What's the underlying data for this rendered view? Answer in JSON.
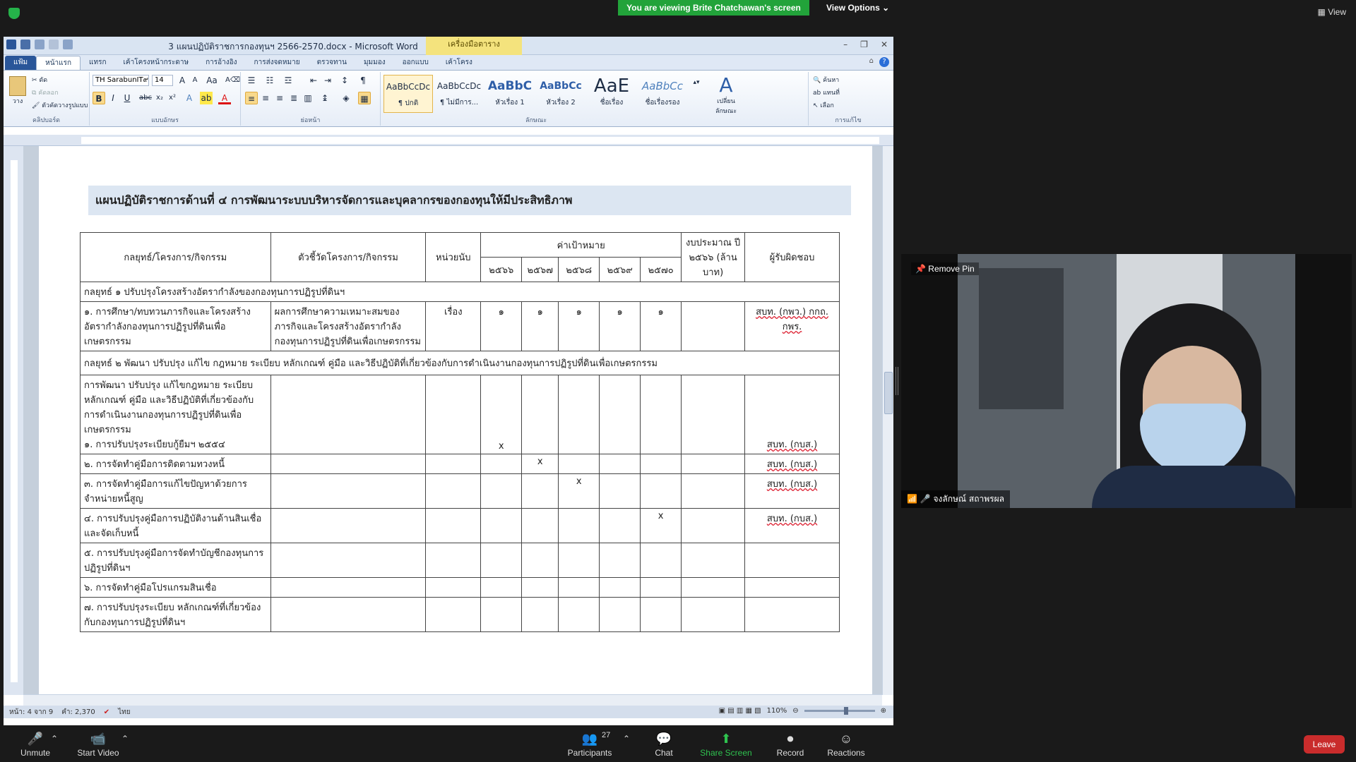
{
  "zoom": {
    "viewing_banner": "You are viewing Brite Chatchawan's screen",
    "view_options": "View Options ⌄",
    "view": "View",
    "pin_label": "Remove Pin",
    "participant_name": "จงลักษณ์ สถาพรผล",
    "participants_count": "27",
    "toolbar": {
      "unmute": "Unmute",
      "start_video": "Start Video",
      "participants": "Participants",
      "chat": "Chat",
      "share_screen": "Share Screen",
      "record": "Record",
      "reactions": "Reactions",
      "leave": "Leave"
    }
  },
  "word": {
    "title": "3 แผนปฏิบัติราชการกองทุนฯ 2566-2570.docx - Microsoft Word",
    "context_tab": "เครื่องมือตาราง",
    "tabs": [
      "แฟ้ม",
      "หน้าแรก",
      "แทรก",
      "เค้าโครงหน้ากระดาษ",
      "การอ้างอิง",
      "การส่งจดหมาย",
      "ตรวจทาน",
      "มุมมอง",
      "ออกแบบ",
      "เค้าโครง"
    ],
    "ribbon": {
      "paste": "วาง",
      "cut": "ตัด",
      "copy": "คัดลอก",
      "format_painter": "ตัวคัดวางรูปแบบ",
      "clipboard_label": "คลิปบอร์ด",
      "font_name": "TH SarabunIT๙",
      "font_size": "14",
      "font_label": "แบบอักษร",
      "paragraph_label": "ย่อหน้า",
      "styles_label": "ลักษณะ",
      "editing_label": "การแก้ไข",
      "change_styles": "เปลี่ยนลักษณะ",
      "find": "ค้นหา",
      "replace": "แทนที่",
      "select": "เลือก",
      "styles": [
        {
          "sample": "AaBbCcDc",
          "name": "¶ ปกติ"
        },
        {
          "sample": "AaBbCcDc",
          "name": "¶ ไม่มีการ..."
        },
        {
          "sample": "AaBbC",
          "name": "หัวเรื่อง 1"
        },
        {
          "sample": "AaBbCc",
          "name": "หัวเรื่อง 2"
        },
        {
          "sample": "AaE",
          "name": "ชื่อเรื่อง"
        },
        {
          "sample": "AaBbCc",
          "name": "ชื่อเรื่องรอง"
        }
      ]
    },
    "status": {
      "page": "หน้า: 4 จาก 9",
      "words": "คำ: 2,370",
      "language": "ไทย",
      "zoom": "110%"
    }
  },
  "document": {
    "heading": "แผนปฏิบัติราชการด้านที่ ๔ การพัฒนาระบบบริหารจัดการและบุคลากรของกองทุนให้มีประสิทธิภาพ",
    "headers": {
      "strategy": "กลยุทธ์/โครงการ/กิจกรรม",
      "indicator": "ตัวชี้วัดโครงการ/กิจกรรม",
      "unit": "หน่วยนับ",
      "target": "ค่าเป้าหมาย",
      "years": [
        "๒๕๖๖",
        "๒๕๖๗",
        "๒๕๖๘",
        "๒๕๖๙",
        "๒๕๗๐"
      ],
      "budget": "งบประมาณ ปี ๒๕๖๖ (ล้านบาท)",
      "owner": "ผู้รับผิดชอบ"
    },
    "strategy1": "กลยุทธ์ ๑ ปรับปรุงโครงสร้างอัตรากำลังของกองทุนการปฏิรูปที่ดินฯ",
    "row1": {
      "item": "๑. การศึกษา/ทบทวนภารกิจและโครงสร้างอัตรากำลังกองทุนการปฏิรูปที่ดินเพื่อเกษตรกรรม",
      "indicator": "ผลการศึกษาความเหมาะสมของภารกิจและโครงสร้างอัตรากำลังกองทุนการปฏิรูปที่ดินเพื่อเกษตรกรรม",
      "unit": "เรื่อง",
      "y1": "๑",
      "y2": "๑",
      "y3": "๑",
      "y4": "๑",
      "y5": "๑",
      "owner": "สบท. (กพว.) กกถ. กพร."
    },
    "strategy2": "กลยุทธ์ ๒ พัฒนา ปรับปรุง แก้ไข กฎหมาย ระเบียบ หลักเกณฑ์ คู่มือ และวิธีปฏิบัติที่เกี่ยวข้องกับการดำเนินงานกองทุนการปฏิรูปที่ดินเพื่อเกษตรกรรม",
    "row2": {
      "item": "การพัฒนา ปรับปรุง แก้ไขกฎหมาย ระเบียบ หลักเกณฑ์ คู่มือ และวิธีปฏิบัติที่เกี่ยวข้องกับการดำเนินงานกองทุนการปฏิรูปที่ดินเพื่อเกษตรกรรม",
      "sub": "๑. การปรับปรุงระเบียบกู้ยืมฯ ๒๕๕๔",
      "mark": "x",
      "owner": "สบท. (กบส.)"
    },
    "row3": {
      "item": "๒. การจัดทำคู่มือการติดตามทวงหนี้",
      "mark": "x",
      "owner": "สบท. (กบส.)"
    },
    "row4": {
      "item": "๓. การจัดทำคู่มือการแก้ไขปัญหาด้วยการจำหน่ายหนี้สูญ",
      "mark": "x",
      "owner": "สบท. (กบส.)"
    },
    "row5": {
      "item": "๔. การปรับปรุงคู่มือการปฏิบัติงานด้านสินเชื่อและจัดเก็บหนี้",
      "mark": "x",
      "owner": "สบท. (กบส.)"
    },
    "row6": {
      "item": "๕. การปรับปรุงคู่มือการจัดทำบัญชีกองทุนการปฏิรูปที่ดินฯ"
    },
    "row7": {
      "item": "๖. การจัดทำคู่มือโปรแกรมสินเชื่อ"
    },
    "row8": {
      "item": "๗. การปรับปรุงระเบียบ หลักเกณฑ์ที่เกี่ยวข้องกับกองทุนการปฏิรูปที่ดินฯ"
    }
  }
}
